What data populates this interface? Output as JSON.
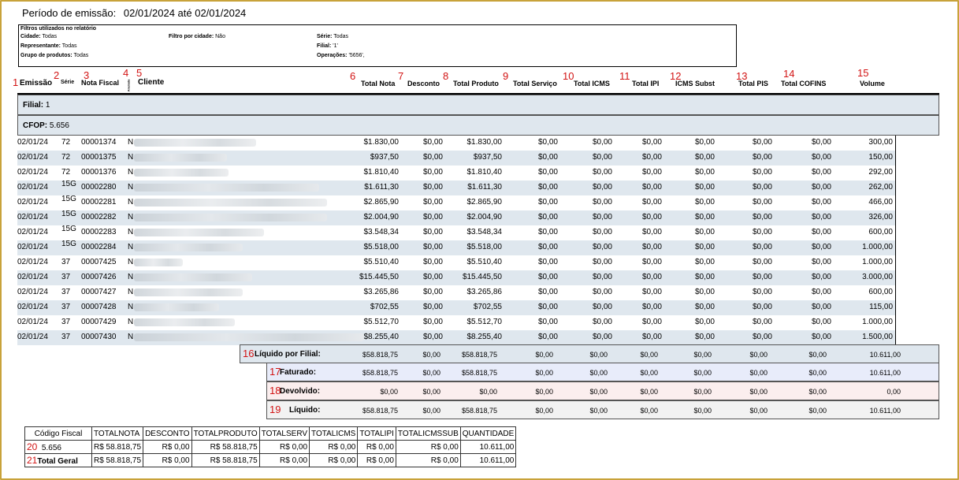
{
  "period": {
    "label": "Período de emissão:",
    "value": "02/01/2024 até 02/01/2024"
  },
  "filters": {
    "title": "Filtros utilizados no relatório",
    "cidade_label": "Cidade:",
    "cidade": "Todas",
    "filtro_cidade_label": "Filtro por cidade:",
    "filtro_cidade": "Não",
    "serie_label": "Série:",
    "serie": "Todas",
    "representante_label": "Representante:",
    "representante": "Todas",
    "filial_label": "Filial:",
    "filial": "'1'",
    "grupo_label": "Grupo de produtos:",
    "grupo": "Todas",
    "operacoes_label": "Operações:",
    "operacoes": "'5656',"
  },
  "columns": {
    "emissao": "Emissão",
    "serie": "Série",
    "nota_fiscal": "Nota Fiscal",
    "anulada": "Anulada",
    "cliente": "Cliente",
    "total_nota": "Total Nota",
    "desconto": "Desconto",
    "total_produto": "Total Produto",
    "total_servico": "Total Serviço",
    "total_icms": "Total ICMS",
    "total_ipi": "Total IPI",
    "icms_subst": "ICMS Subst",
    "total_pis": "Total PIS",
    "total_cofins": "Total COFINS",
    "volume": "Volume"
  },
  "markers": [
    "1",
    "2",
    "3",
    "4",
    "5",
    "6",
    "7",
    "8",
    "9",
    "10",
    "11",
    "12",
    "13",
    "14",
    "15",
    "16",
    "17",
    "18",
    "19",
    "20",
    "21"
  ],
  "filial": {
    "label": "Filial:",
    "value": "1"
  },
  "cfop": {
    "label": "CFOP:",
    "value": "5.656"
  },
  "rows": [
    {
      "emissao": "02/01/24",
      "serie": "72",
      "nf": "00001374",
      "a": "N",
      "total": "$1.830,00",
      "desc": "$0,00",
      "prod": "$1.830,00",
      "serv": "$0,00",
      "icms": "$0,00",
      "ipi": "$0,00",
      "subst": "$0,00",
      "pis": "$0,00",
      "cofins": "$0,00",
      "vol": "300,00"
    },
    {
      "emissao": "02/01/24",
      "serie": "72",
      "nf": "00001375",
      "a": "N",
      "total": "$937,50",
      "desc": "$0,00",
      "prod": "$937,50",
      "serv": "$0,00",
      "icms": "$0,00",
      "ipi": "$0,00",
      "subst": "$0,00",
      "pis": "$0,00",
      "cofins": "$0,00",
      "vol": "150,00"
    },
    {
      "emissao": "02/01/24",
      "serie": "72",
      "nf": "00001376",
      "a": "N",
      "total": "$1.810,40",
      "desc": "$0,00",
      "prod": "$1.810,40",
      "serv": "$0,00",
      "icms": "$0,00",
      "ipi": "$0,00",
      "subst": "$0,00",
      "pis": "$0,00",
      "cofins": "$0,00",
      "vol": "292,00"
    },
    {
      "emissao": "02/01/24",
      "serie": "15G",
      "nf": "00002280",
      "a": "N",
      "total": "$1.611,30",
      "desc": "$0,00",
      "prod": "$1.611,30",
      "serv": "$0,00",
      "icms": "$0,00",
      "ipi": "$0,00",
      "subst": "$0,00",
      "pis": "$0,00",
      "cofins": "$0,00",
      "vol": "262,00"
    },
    {
      "emissao": "02/01/24",
      "serie": "15G",
      "nf": "00002281",
      "a": "N",
      "total": "$2.865,90",
      "desc": "$0,00",
      "prod": "$2.865,90",
      "serv": "$0,00",
      "icms": "$0,00",
      "ipi": "$0,00",
      "subst": "$0,00",
      "pis": "$0,00",
      "cofins": "$0,00",
      "vol": "466,00"
    },
    {
      "emissao": "02/01/24",
      "serie": "15G",
      "nf": "00002282",
      "a": "N",
      "total": "$2.004,90",
      "desc": "$0,00",
      "prod": "$2.004,90",
      "serv": "$0,00",
      "icms": "$0,00",
      "ipi": "$0,00",
      "subst": "$0,00",
      "pis": "$0,00",
      "cofins": "$0,00",
      "vol": "326,00"
    },
    {
      "emissao": "02/01/24",
      "serie": "15G",
      "nf": "00002283",
      "a": "N",
      "total": "$3.548,34",
      "desc": "$0,00",
      "prod": "$3.548,34",
      "serv": "$0,00",
      "icms": "$0,00",
      "ipi": "$0,00",
      "subst": "$0,00",
      "pis": "$0,00",
      "cofins": "$0,00",
      "vol": "600,00"
    },
    {
      "emissao": "02/01/24",
      "serie": "15G",
      "nf": "00002284",
      "a": "N",
      "total": "$5.518,00",
      "desc": "$0,00",
      "prod": "$5.518,00",
      "serv": "$0,00",
      "icms": "$0,00",
      "ipi": "$0,00",
      "subst": "$0,00",
      "pis": "$0,00",
      "cofins": "$0,00",
      "vol": "1.000,00"
    },
    {
      "emissao": "02/01/24",
      "serie": "37",
      "nf": "00007425",
      "a": "N",
      "total": "$5.510,40",
      "desc": "$0,00",
      "prod": "$5.510,40",
      "serv": "$0,00",
      "icms": "$0,00",
      "ipi": "$0,00",
      "subst": "$0,00",
      "pis": "$0,00",
      "cofins": "$0,00",
      "vol": "1.000,00"
    },
    {
      "emissao": "02/01/24",
      "serie": "37",
      "nf": "00007426",
      "a": "N",
      "total": "$15.445,50",
      "desc": "$0,00",
      "prod": "$15.445,50",
      "serv": "$0,00",
      "icms": "$0,00",
      "ipi": "$0,00",
      "subst": "$0,00",
      "pis": "$0,00",
      "cofins": "$0,00",
      "vol": "3.000,00"
    },
    {
      "emissao": "02/01/24",
      "serie": "37",
      "nf": "00007427",
      "a": "N",
      "total": "$3.265,86",
      "desc": "$0,00",
      "prod": "$3.265,86",
      "serv": "$0,00",
      "icms": "$0,00",
      "ipi": "$0,00",
      "subst": "$0,00",
      "pis": "$0,00",
      "cofins": "$0,00",
      "vol": "600,00"
    },
    {
      "emissao": "02/01/24",
      "serie": "37",
      "nf": "00007428",
      "a": "N",
      "total": "$702,55",
      "desc": "$0,00",
      "prod": "$702,55",
      "serv": "$0,00",
      "icms": "$0,00",
      "ipi": "$0,00",
      "subst": "$0,00",
      "pis": "$0,00",
      "cofins": "$0,00",
      "vol": "115,00"
    },
    {
      "emissao": "02/01/24",
      "serie": "37",
      "nf": "00007429",
      "a": "N",
      "total": "$5.512,70",
      "desc": "$0,00",
      "prod": "$5.512,70",
      "serv": "$0,00",
      "icms": "$0,00",
      "ipi": "$0,00",
      "subst": "$0,00",
      "pis": "$0,00",
      "cofins": "$0,00",
      "vol": "1.000,00"
    },
    {
      "emissao": "02/01/24",
      "serie": "37",
      "nf": "00007430",
      "a": "N",
      "total": "$8.255,40",
      "desc": "$0,00",
      "prod": "$8.255,40",
      "serv": "$0,00",
      "icms": "$0,00",
      "ipi": "$0,00",
      "subst": "$0,00",
      "pis": "$0,00",
      "cofins": "$0,00",
      "vol": "1.500,00"
    }
  ],
  "summaries": [
    {
      "label": "Líquido por Filial:",
      "total": "$58.818,75",
      "desc": "$0,00",
      "prod": "$58.818,75",
      "serv": "$0,00",
      "icms": "$0,00",
      "ipi": "$0,00",
      "subst": "$0,00",
      "pis": "$0,00",
      "cofins": "$0,00",
      "vol": "10.611,00",
      "bg": "#dfe7ee"
    },
    {
      "label": "Faturado:",
      "total": "$58.818,75",
      "desc": "$0,00",
      "prod": "$58.818,75",
      "serv": "$0,00",
      "icms": "$0,00",
      "ipi": "$0,00",
      "subst": "$0,00",
      "pis": "$0,00",
      "cofins": "$0,00",
      "vol": "10.611,00",
      "bg": "#e8ecfa"
    },
    {
      "label": "Devolvido:",
      "total": "$0,00",
      "desc": "$0,00",
      "prod": "$0,00",
      "serv": "$0,00",
      "icms": "$0,00",
      "ipi": "$0,00",
      "subst": "$0,00",
      "pis": "$0,00",
      "cofins": "$0,00",
      "vol": "0,00",
      "bg": "#fbeeee"
    },
    {
      "label": "Líquido:",
      "total": "$58.818,75",
      "desc": "$0,00",
      "prod": "$58.818,75",
      "serv": "$0,00",
      "icms": "$0,00",
      "ipi": "$0,00",
      "subst": "$0,00",
      "pis": "$0,00",
      "cofins": "$0,00",
      "vol": "10.611,00",
      "bg": "#f2f2f2"
    }
  ],
  "totals_table": {
    "headers": [
      "Código Fiscal",
      "TOTALNOTA",
      "DESCONTO",
      "TOTALPRODUTO",
      "TOTALSERV",
      "TOTALICMS",
      "TOTALIPI",
      "TOTALICMSSUB",
      "QUANTIDADE"
    ],
    "rows": [
      [
        "5.656",
        "R$ 58.818,75",
        "R$ 0,00",
        "R$ 58.818,75",
        "R$ 0,00",
        "R$ 0,00",
        "R$ 0,00",
        "R$ 0,00",
        "10.611,00"
      ],
      [
        "Total Geral",
        "R$ 58.818,75",
        "R$ 0,00",
        "R$ 58.818,75",
        "R$ 0,00",
        "R$ 0,00",
        "R$ 0,00",
        "R$ 0,00",
        "10.611,00"
      ]
    ]
  },
  "colors": {
    "frame": "#c8a23a",
    "band": "#dfe7ee",
    "marker": "#d21414"
  }
}
